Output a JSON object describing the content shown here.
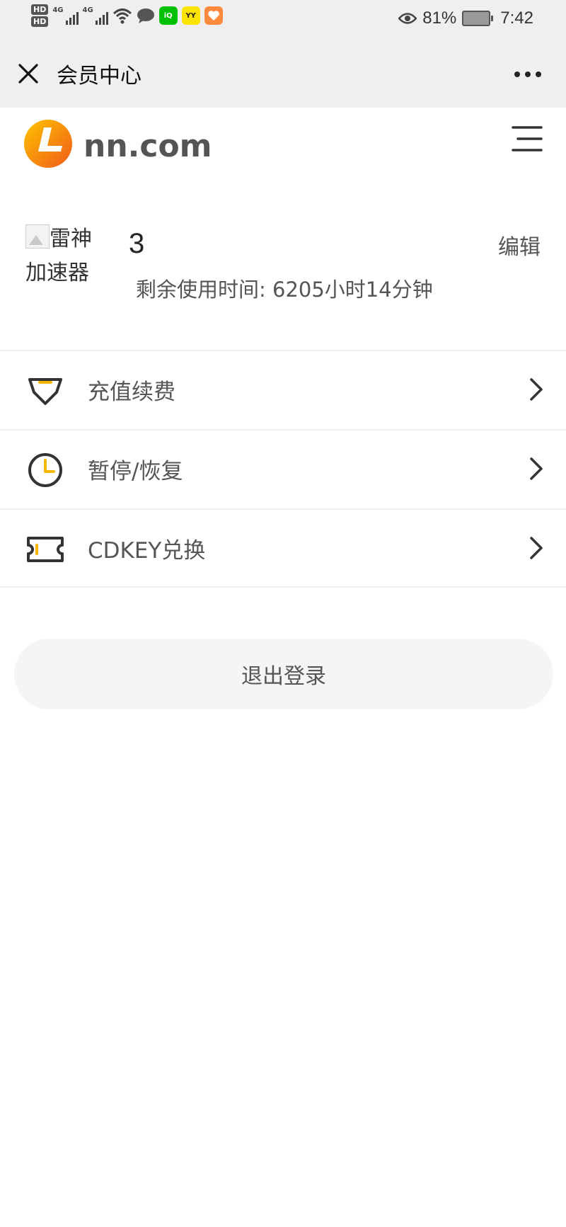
{
  "status_bar": {
    "hd1": "HD",
    "hd2": "HD",
    "net1": "4G",
    "net2": "4G",
    "yy_label": "YY",
    "battery_percent": "81%",
    "time": "7:42",
    "icons": [
      "hd-icon",
      "signal-icon",
      "wifi-icon",
      "message-icon",
      "iqiyi-icon",
      "yy-icon",
      "heart-app-icon",
      "eye-icon",
      "battery-icon"
    ]
  },
  "titlebar": {
    "title": "会员中心"
  },
  "header": {
    "logo_text": "nn.com"
  },
  "user": {
    "avatar_alt": "雷神加速器",
    "username": "3",
    "edit_label": "编辑",
    "remaining_label": "剩余使用时间:",
    "remaining_value": "6205小时14分钟"
  },
  "menu": [
    {
      "label": "充值续费",
      "icon": "diamond-icon"
    },
    {
      "label": "暂停/恢复",
      "icon": "clock-icon"
    },
    {
      "label": "CDKEY兑换",
      "icon": "ticket-icon"
    }
  ],
  "logout_label": "退出登录",
  "colors": {
    "accent": "#f5b800",
    "logo_orange": "#f26b1d",
    "bar_bg": "#efefef"
  }
}
